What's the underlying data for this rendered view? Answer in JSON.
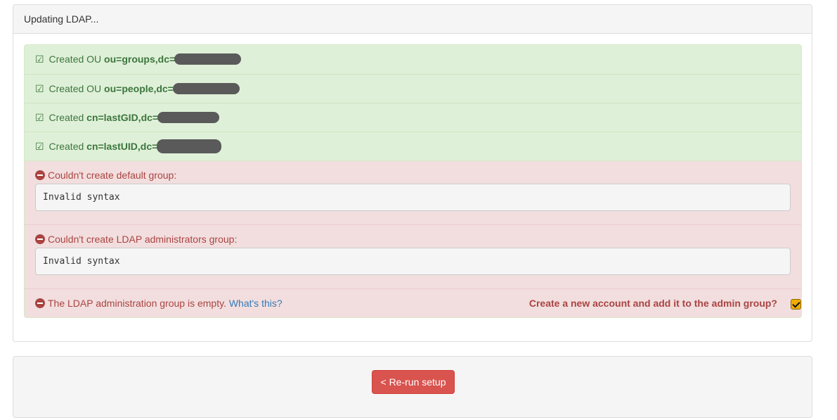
{
  "panel": {
    "title": "Updating LDAP..."
  },
  "results": {
    "created": [
      {
        "check": "☑",
        "prefix": "Created OU",
        "dn": "ou=groups,dc="
      },
      {
        "check": "☑",
        "prefix": "Created OU",
        "dn": "ou=people,dc="
      },
      {
        "check": "☑",
        "prefix": "Created",
        "dn": "cn=lastGID,dc="
      },
      {
        "check": "☑",
        "prefix": "Created",
        "dn": "cn=lastUID,dc="
      }
    ],
    "errors": [
      {
        "message": "Couldn't create default group:",
        "detail": "Invalid syntax"
      },
      {
        "message": "Couldn't create LDAP administrators group:",
        "detail": "Invalid syntax"
      }
    ],
    "admin_warning": {
      "message": "The LDAP administration group is empty.",
      "link": "What's this?",
      "create_label": "Create a new account and add it to the admin group?",
      "create_checked": true
    }
  },
  "footer": {
    "rerun_label": "< Re-run setup"
  },
  "icons": {
    "success": "checkbox-checked-icon",
    "error": "no-entry-icon"
  },
  "colors": {
    "success_bg": "#dff0d8",
    "success_text": "#3c763d",
    "danger_bg": "#f2dede",
    "danger_text": "#a94442",
    "link": "#337ab7",
    "button": "#d9534f"
  }
}
